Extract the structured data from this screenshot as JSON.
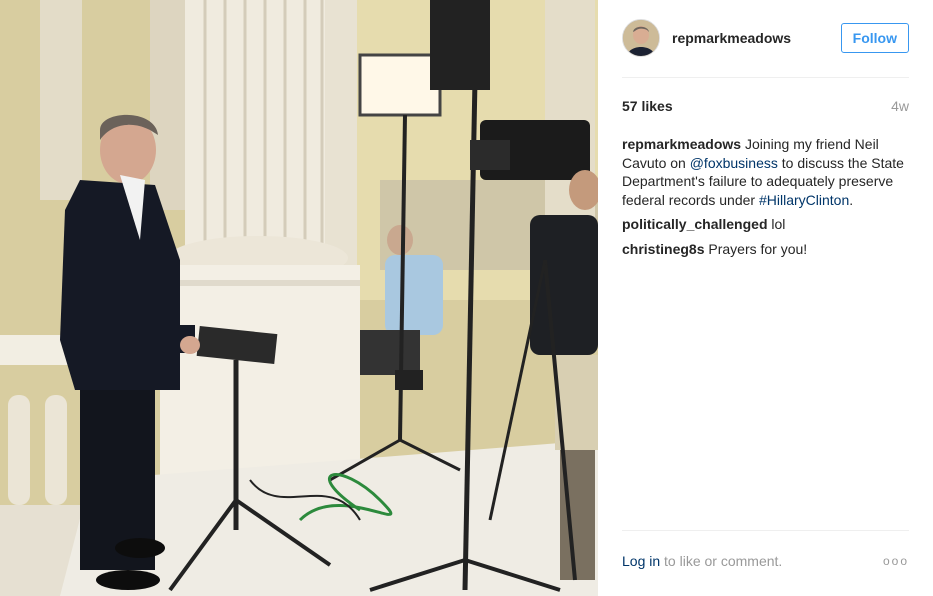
{
  "post": {
    "username": "repmarkmeadows",
    "follow_label": "Follow",
    "likes": "57 likes",
    "age": "4w",
    "caption": {
      "user": "repmarkmeadows",
      "text_1": "Joining my friend Neil Cavuto on ",
      "mention": "@foxbusiness",
      "text_2": " to discuss the State Department's failure to adequately preserve federal records under ",
      "hashtag": "#HillaryClinton",
      "text_3": "."
    },
    "comments": [
      {
        "user": "politically_challenged",
        "text": "lol"
      },
      {
        "user": "christineg8s",
        "text": "Prayers for you!"
      }
    ],
    "footer": {
      "login": "Log in",
      "rest": " to like or comment.",
      "more": "ooo"
    }
  },
  "colors": {
    "accent": "#3897f0",
    "link": "#003569",
    "muted": "#999999"
  }
}
